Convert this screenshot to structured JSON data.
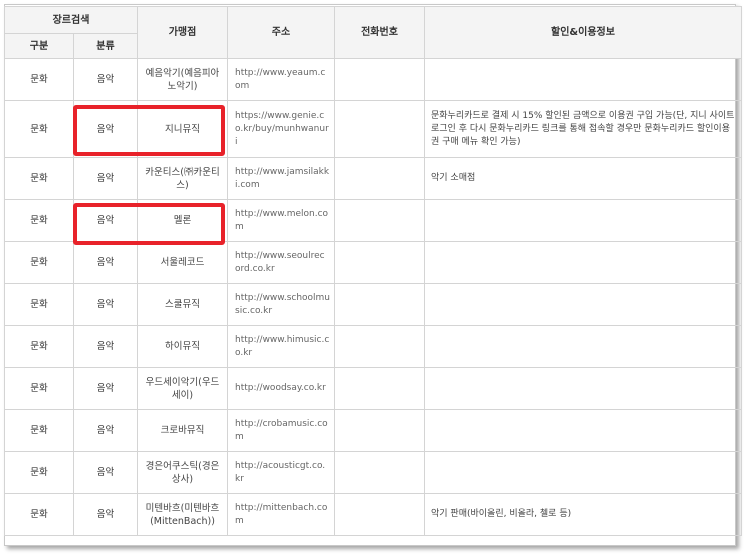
{
  "table": {
    "headers": {
      "genre_search": "장르검색",
      "category": "구분",
      "classification": "분류",
      "store": "가맹점",
      "address": "주소",
      "phone": "전화번호",
      "discount_info": "할인&이용정보"
    },
    "rows": [
      {
        "category": "문화",
        "classification": "음악",
        "store": "예음악기(예음피아노악기)",
        "address": "http://www.yeaum.com",
        "phone": "",
        "info": ""
      },
      {
        "category": "문화",
        "classification": "음악",
        "store": "지니뮤직",
        "address": "https://www.genie.co.kr/buy/munhwanuri",
        "phone": "",
        "info": "문화누리카드로 결제 시 15% 할인된 금액으로 이용권 구입 가능(단, 지니 사이트 로그인 후 다시 문화누리카드 링크를 통해 접속할 경우만 문화누리카드 할인이용권 구매 메뉴 확인 가능)"
      },
      {
        "category": "문화",
        "classification": "음악",
        "store": "카운티스(㈜카운티스)",
        "address": "http://www.jamsilakki.com",
        "phone": "",
        "info": "악기 소매점"
      },
      {
        "category": "문화",
        "classification": "음악",
        "store": "멜론",
        "address": "http://www.melon.com",
        "phone": "",
        "info": ""
      },
      {
        "category": "문화",
        "classification": "음악",
        "store": "서울레코드",
        "address": "http://www.seoulrecord.co.kr",
        "phone": "",
        "info": ""
      },
      {
        "category": "문화",
        "classification": "음악",
        "store": "스쿨뮤직",
        "address": "http://www.schoolmusic.co.kr",
        "phone": "",
        "info": ""
      },
      {
        "category": "문화",
        "classification": "음악",
        "store": "하이뮤직",
        "address": "http://www.himusic.co.kr",
        "phone": "",
        "info": ""
      },
      {
        "category": "문화",
        "classification": "음악",
        "store": "우드세이악기(우드세이)",
        "address": "http://woodsay.co.kr",
        "phone": "",
        "info": ""
      },
      {
        "category": "문화",
        "classification": "음악",
        "store": "크로바뮤직",
        "address": "http://crobamusic.com",
        "phone": "",
        "info": ""
      },
      {
        "category": "문화",
        "classification": "음악",
        "store": "경은어쿠스틱(경은상사)",
        "address": "http://acousticgt.co.kr",
        "phone": "",
        "info": ""
      },
      {
        "category": "문화",
        "classification": "음악",
        "store": "미텐바흐(미텐바흐(MittenBach))",
        "address": "http://mittenbach.com",
        "phone": "",
        "info": "악기 판매(바이올린, 비올라, 첼로 등)"
      }
    ]
  },
  "highlight_color": "#e8222a"
}
